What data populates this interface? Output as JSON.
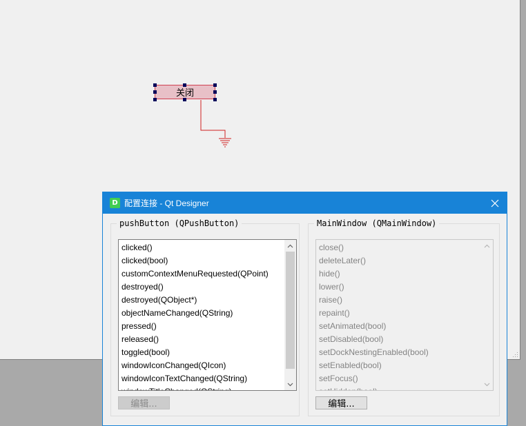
{
  "form": {
    "button_label": "关闭"
  },
  "dialog": {
    "title": "配置连接 - Qt Designer",
    "app_icon_letter": "D",
    "close_glyph": "✕",
    "left_group": {
      "title": "pushButton (QPushButton)",
      "items": [
        "clicked()",
        "clicked(bool)",
        "customContextMenuRequested(QPoint)",
        "destroyed()",
        "destroyed(QObject*)",
        "objectNameChanged(QString)",
        "pressed()",
        "released()",
        "toggled(bool)",
        "windowIconChanged(QIcon)",
        "windowIconTextChanged(QString)",
        "windowTitleChanged(QString)"
      ],
      "edit_label": "编辑..."
    },
    "right_group": {
      "title": "MainWindow (QMainWindow)",
      "items": [
        "close()",
        "deleteLater()",
        "hide()",
        "lower()",
        "raise()",
        "repaint()",
        "setAnimated(bool)",
        "setDisabled(bool)",
        "setDockNestingEnabled(bool)",
        "setEnabled(bool)",
        "setFocus()",
        "setHidden(bool)"
      ],
      "edit_label": "编辑..."
    }
  },
  "colors": {
    "titlebar": "#1883d7",
    "connection_line": "#d02020",
    "selected_widget_fill": "#e8c0c7"
  }
}
